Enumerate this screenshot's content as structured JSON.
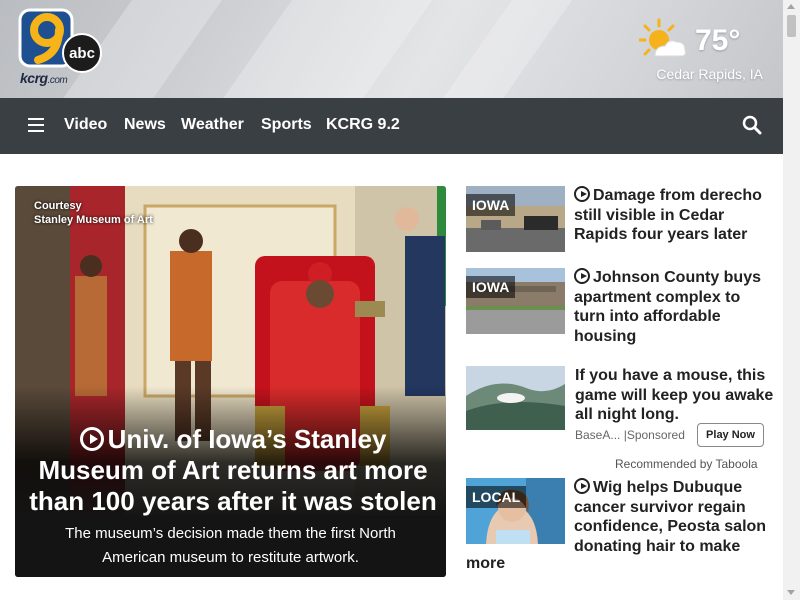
{
  "header": {
    "logo": {
      "network": "abc",
      "station": "kcrg",
      "domain": ".com"
    },
    "weather": {
      "temperature": "75°",
      "location": "Cedar Rapids, IA",
      "icon": "partly-sunny-icon"
    }
  },
  "nav": {
    "items": [
      {
        "label": "Video"
      },
      {
        "label": "News"
      },
      {
        "label": "Weather"
      },
      {
        "label": "Sports"
      },
      {
        "label": "KCRG 9.2"
      }
    ]
  },
  "hero": {
    "credit_line1": "Courtesy",
    "credit_line2": "Stanley Museum of Art",
    "title": "Univ. of Iowa’s Stanley Museum of Art returns art more than 100 years after it was stolen",
    "description": "The museum’s decision made them the first North American museum to restitute artwork."
  },
  "stories": [
    {
      "tag": "IOWA",
      "headline": "Damage from derecho still visible in Cedar Rapids four years later"
    },
    {
      "tag": "IOWA",
      "headline": "Johnson County buys apartment complex to turn into affordable housing"
    }
  ],
  "sponsored": {
    "headline": "If you have a mouse, this game will keep you awake all night long.",
    "source": "BaseA...",
    "label": "|Sponsored",
    "button": "Play Now",
    "recommended": "Recommended by Taboola"
  },
  "local": {
    "tag": "LOCAL",
    "headline": "Wig helps Dubuque cancer survivor regain confidence, Peosta salon donating hair to make",
    "more": "more"
  },
  "colors": {
    "nav_bg": "#3a3f44",
    "accent": "#f2a81d",
    "text": "#222222"
  }
}
